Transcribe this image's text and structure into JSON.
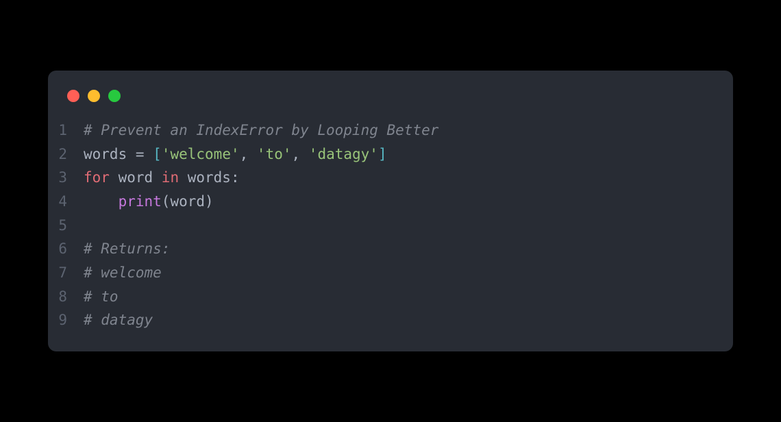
{
  "window": {
    "controls": {
      "close_color": "#ff5f56",
      "minimize_color": "#ffbd2e",
      "maximize_color": "#27c93f"
    }
  },
  "code": {
    "lines": [
      {
        "number": "1",
        "tokens": [
          {
            "text": "# Prevent an IndexError by Looping Better",
            "type": "comment"
          }
        ]
      },
      {
        "number": "2",
        "tokens": [
          {
            "text": "words ",
            "type": "default"
          },
          {
            "text": "=",
            "type": "operator"
          },
          {
            "text": " ",
            "type": "default"
          },
          {
            "text": "[",
            "type": "bracket"
          },
          {
            "text": "'welcome'",
            "type": "string"
          },
          {
            "text": ", ",
            "type": "default"
          },
          {
            "text": "'to'",
            "type": "string"
          },
          {
            "text": ", ",
            "type": "default"
          },
          {
            "text": "'datagy'",
            "type": "string"
          },
          {
            "text": "]",
            "type": "bracket"
          }
        ]
      },
      {
        "number": "3",
        "tokens": [
          {
            "text": "for",
            "type": "keyword-red"
          },
          {
            "text": " word ",
            "type": "default"
          },
          {
            "text": "in",
            "type": "keyword-red"
          },
          {
            "text": " words:",
            "type": "default"
          }
        ]
      },
      {
        "number": "4",
        "tokens": [
          {
            "text": "    ",
            "type": "default"
          },
          {
            "text": "print",
            "type": "builtin"
          },
          {
            "text": "(word)",
            "type": "default"
          }
        ]
      },
      {
        "number": "5",
        "tokens": []
      },
      {
        "number": "6",
        "tokens": [
          {
            "text": "# Returns:",
            "type": "comment"
          }
        ]
      },
      {
        "number": "7",
        "tokens": [
          {
            "text": "# welcome",
            "type": "comment"
          }
        ]
      },
      {
        "number": "8",
        "tokens": [
          {
            "text": "# to",
            "type": "comment"
          }
        ]
      },
      {
        "number": "9",
        "tokens": [
          {
            "text": "# datagy",
            "type": "comment"
          }
        ]
      }
    ]
  }
}
